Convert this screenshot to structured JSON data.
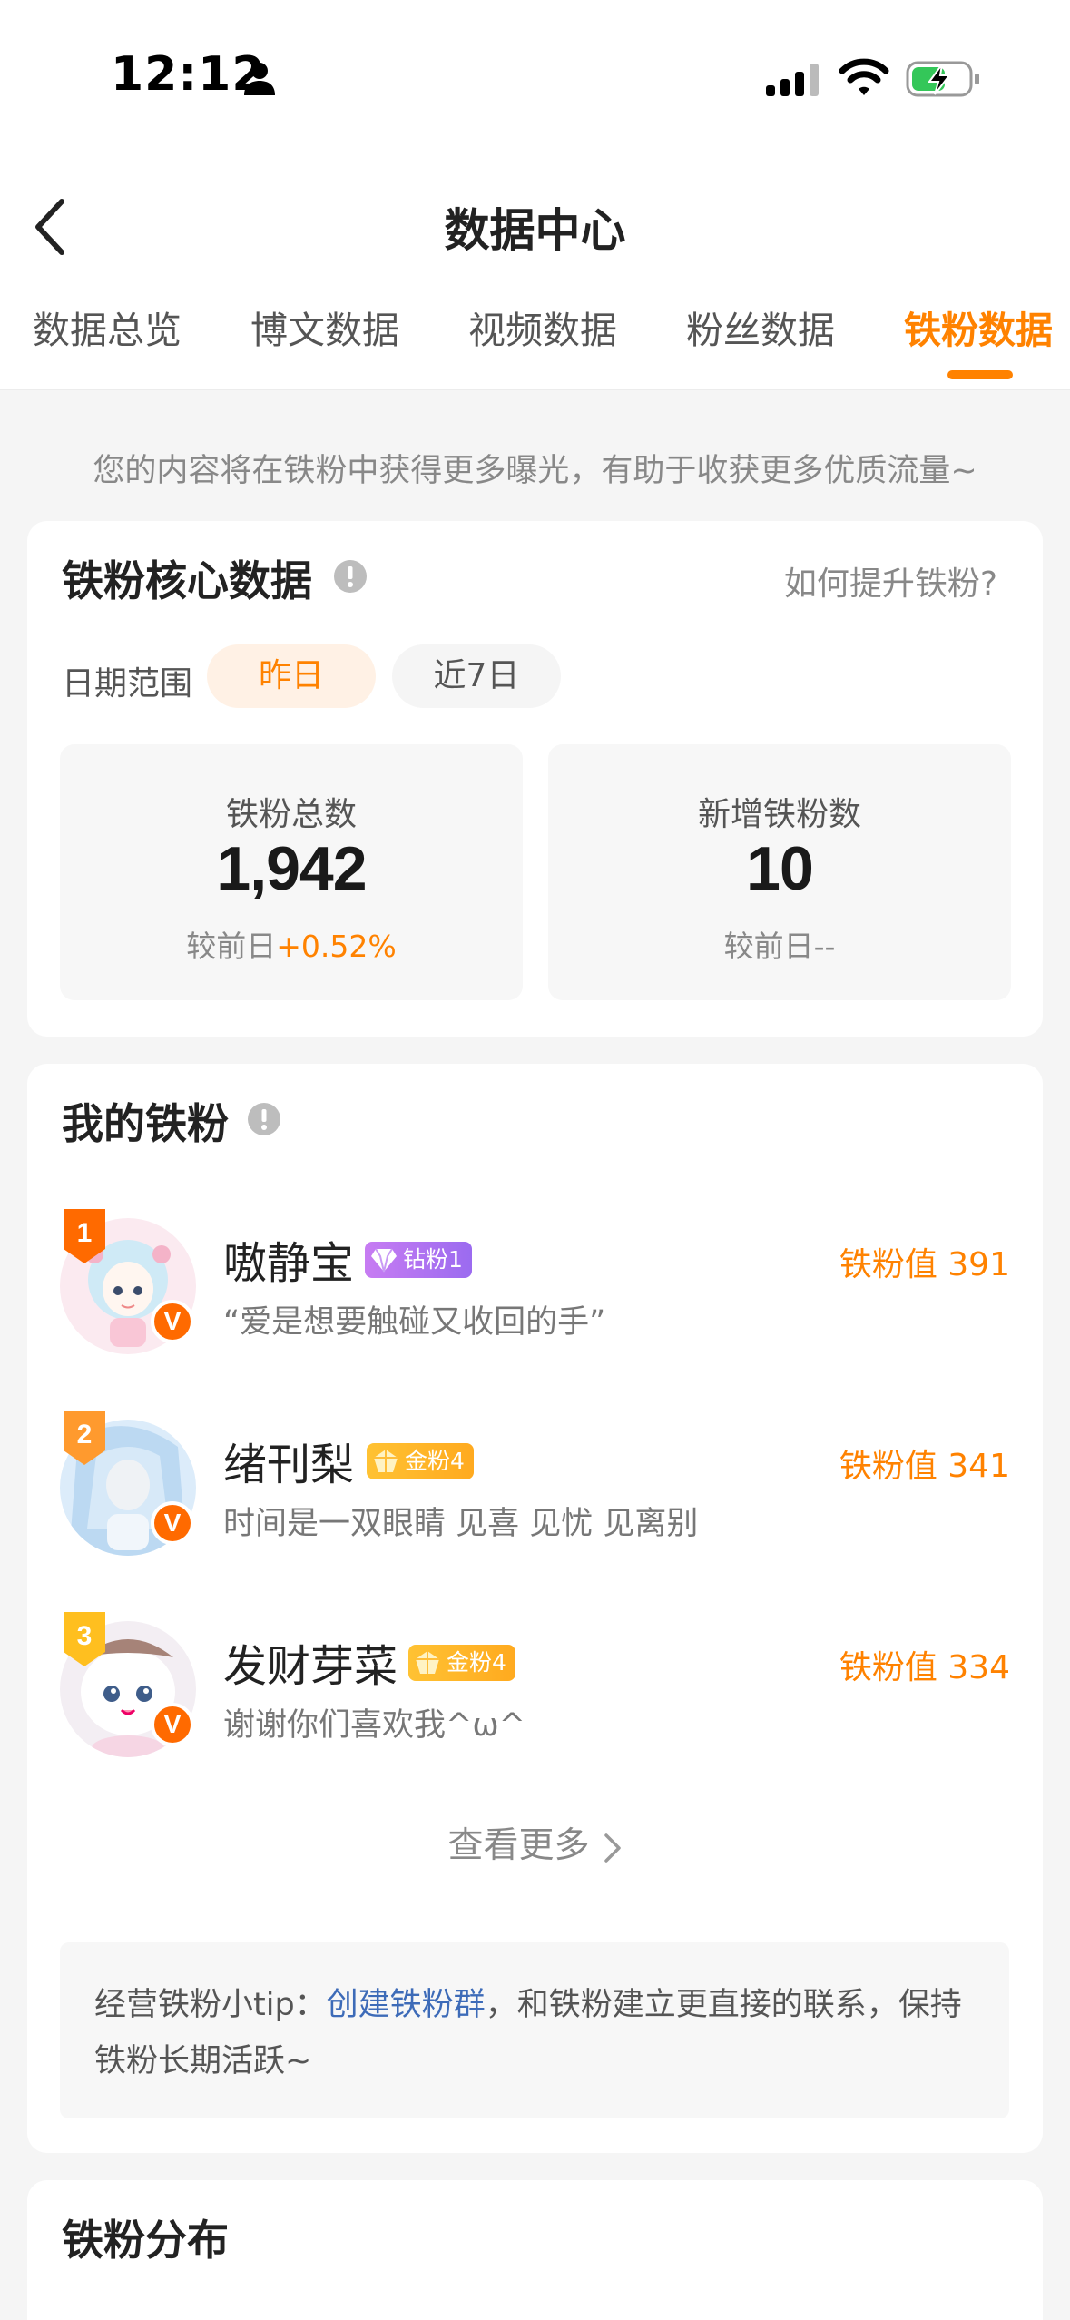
{
  "status_bar": {
    "time": "12:12"
  },
  "header": {
    "title": "数据中心",
    "tabs": [
      {
        "label": "数据总览",
        "active": false
      },
      {
        "label": "博文数据",
        "active": false
      },
      {
        "label": "视频数据",
        "active": false
      },
      {
        "label": "粉丝数据",
        "active": false
      },
      {
        "label": "铁粉数据",
        "active": true
      }
    ]
  },
  "notice": "您的内容将在铁粉中获得更多曝光，有助于收获更多优质流量~",
  "core": {
    "title": "铁粉核心数据",
    "help_link": "如何提升铁粉?",
    "date_label": "日期范围",
    "date_options": [
      "昨日",
      "近7日"
    ],
    "selected_date": "昨日",
    "stats": [
      {
        "label": "铁粉总数",
        "value": "1,942",
        "compare_prefix": "较前日",
        "compare_value": "+0.52%"
      },
      {
        "label": "新增铁粉数",
        "value": "10",
        "compare_prefix": "较前日",
        "compare_value": "--"
      }
    ]
  },
  "my_fans": {
    "title": "我的铁粉",
    "fans": [
      {
        "rank": "1",
        "name": "嗷静宝",
        "badge": "钻粉1",
        "badge_type": "diamond",
        "score": "铁粉值 391",
        "quote": "“爱是想要触碰又收回的手”"
      },
      {
        "rank": "2",
        "name": "绪刊梨",
        "badge": "金粉4",
        "badge_type": "gold",
        "score": "铁粉值 341",
        "quote": "时间是一双眼睛 见喜 见忧 见离别"
      },
      {
        "rank": "3",
        "name": "发财芽菜",
        "badge": "金粉4",
        "badge_type": "gold",
        "score": "铁粉值 334",
        "quote": "谢谢你们喜欢我^ω^"
      }
    ],
    "more_label": "查看更多",
    "tip_prefix": "经营铁粉小tip：",
    "tip_link": "创建铁粉群",
    "tip_suffix": "，和铁粉建立更直接的联系，保持铁粉长期活跃~"
  },
  "distribution": {
    "title": "铁粉分布"
  },
  "colors": {
    "accent": "#ff8200",
    "link": "#3d6bb8",
    "diamond": "#9b6bf0",
    "gold": "#ffaa1f"
  }
}
